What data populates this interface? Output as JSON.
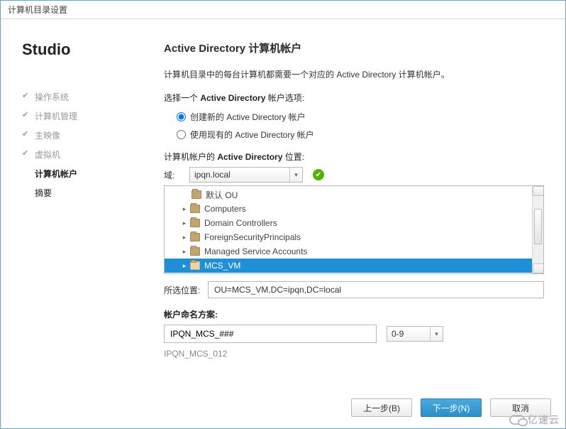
{
  "window": {
    "title": "计算机目录设置"
  },
  "sidebar": {
    "brand": "Studio",
    "steps": [
      {
        "label": "操作系统",
        "state": "done"
      },
      {
        "label": "计算机管理",
        "state": "done"
      },
      {
        "label": "主映像",
        "state": "done"
      },
      {
        "label": "虚拟机",
        "state": "done"
      },
      {
        "label": "计算机帐户",
        "state": "current"
      },
      {
        "label": "摘要",
        "state": "future"
      }
    ]
  },
  "main": {
    "heading": "Active Directory 计算机帐户",
    "description": "计算机目录中的每台计算机都需要一个对应的 Active Directory 计算机帐户。",
    "option_label_pre": "选择一个 ",
    "option_label_bold": "Active Directory",
    "option_label_post": " 帐户选项:",
    "radio": {
      "create": "创建新的 Active Directory 帐户",
      "use": "使用现有的 Active Directory 帐户",
      "selected": "create"
    },
    "location_label_pre": "计算机帐户的 ",
    "location_label_bold": "Active Directory",
    "location_label_post": " 位置:",
    "domain_label": "域:",
    "domain_value": "ipqn.local",
    "tree": [
      {
        "label": "默认 OU",
        "expandable": false,
        "selected": false
      },
      {
        "label": "Computers",
        "expandable": true,
        "selected": false
      },
      {
        "label": "Domain Controllers",
        "expandable": true,
        "selected": false
      },
      {
        "label": "ForeignSecurityPrincipals",
        "expandable": true,
        "selected": false
      },
      {
        "label": "Managed Service Accounts",
        "expandable": true,
        "selected": false
      },
      {
        "label": "MCS_VM",
        "expandable": true,
        "selected": true
      }
    ],
    "selected_location_label": "所选位置:",
    "selected_location_value": "OU=MCS_VM,DC=ipqn,DC=local",
    "scheme_label": "帐户命名方案:",
    "scheme_value": "IPQN_MCS_###",
    "scheme_range": "0-9",
    "scheme_example": "IPQN_MCS_012"
  },
  "footer": {
    "back": "上一步(B)",
    "next": "下一步(N)",
    "cancel": "取消"
  },
  "watermark": "亿速云"
}
